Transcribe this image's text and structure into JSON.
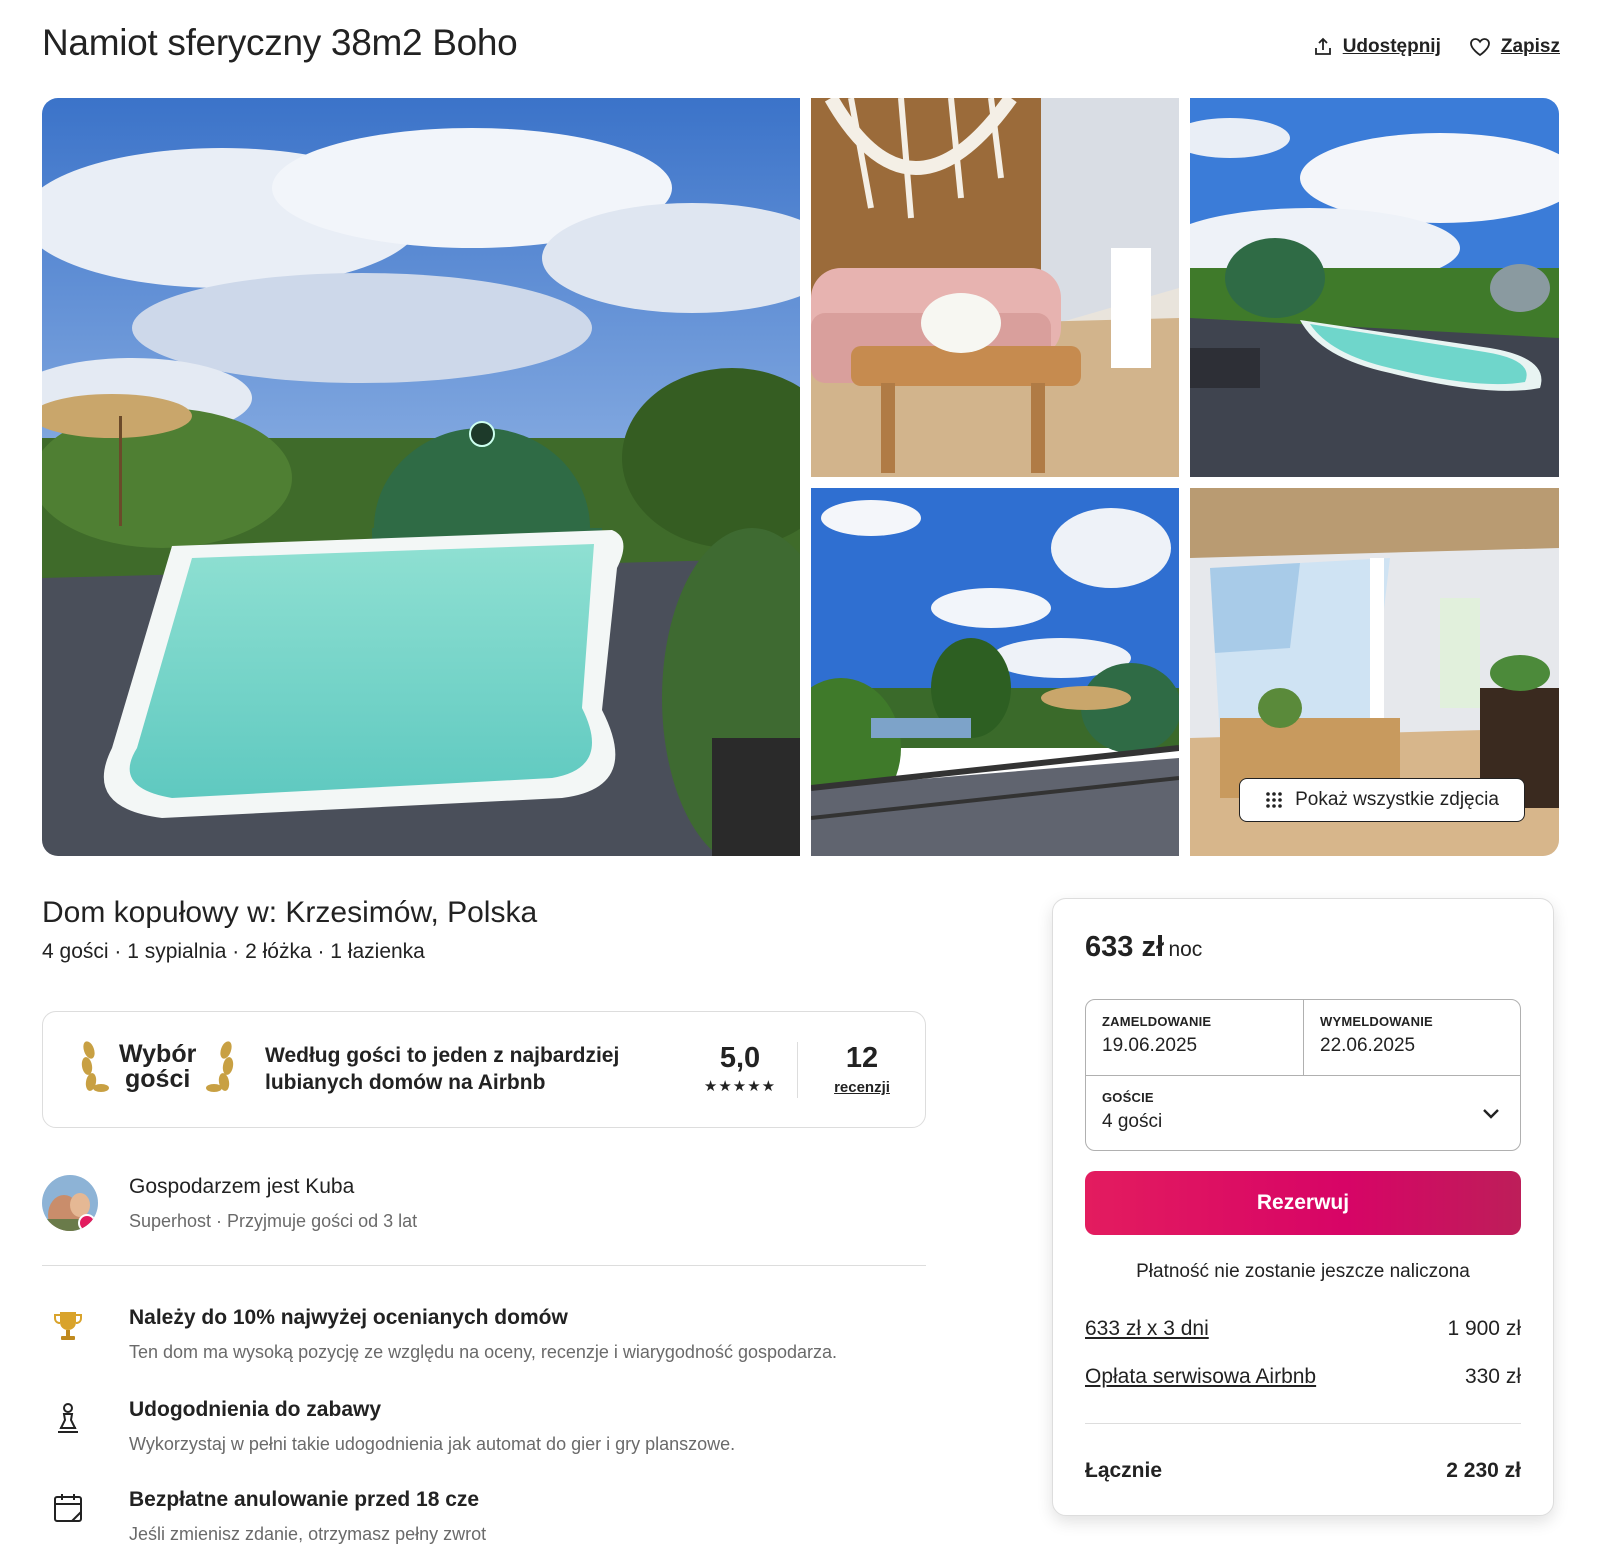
{
  "header": {
    "title": "Namiot sferyczny 38m2 Boho",
    "share_label": "Udostępnij",
    "save_label": "Zapisz"
  },
  "gallery": {
    "photos": [
      "pool-dome-exterior",
      "boho-living-room",
      "pool-aerial-view",
      "deck-lake-view",
      "dome-interior"
    ],
    "show_all_label": "Pokaż wszystkie zdjęcia"
  },
  "listing": {
    "subtitle": "Dom kopułowy w: Krzesimów, Polska",
    "specs": "4 gości · 1 sypialnia · 2 łóżka · 1 łazienka"
  },
  "guest_favorite": {
    "badge_line1": "Wybór",
    "badge_line2": "gości",
    "description": "Według gości to jeden z najbardziej lubianych domów na Airbnb",
    "rating": "5,0",
    "stars": "★★★★★",
    "reviews_count": "12",
    "reviews_label": "recenzji"
  },
  "host": {
    "name_line": "Gospodarzem jest Kuba",
    "meta": "Superhost · Przyjmuje gości od 3 lat"
  },
  "highlights": [
    {
      "icon": "trophy-icon",
      "title": "Należy do 10% najwyżej ocenianych domów",
      "text": "Ten dom ma wysoką pozycję ze względu na oceny, recenzje i wiarygodność gospodarza."
    },
    {
      "icon": "chess-pawn-icon",
      "title": "Udogodnienia do zabawy",
      "text": "Wykorzystaj w pełni takie udogodnienia jak automat do gier i gry planszowe."
    },
    {
      "icon": "calendar-icon",
      "title": "Bezpłatne anulowanie przed 18 cze",
      "text": "Jeśli zmienisz zdanie, otrzymasz pełny zwrot"
    }
  ],
  "booking": {
    "price": "633 zł",
    "price_unit": "noc",
    "checkin_label": "ZAMELDOWANIE",
    "checkin_value": "19.06.2025",
    "checkout_label": "WYMELDOWANIE",
    "checkout_value": "22.06.2025",
    "guests_label": "GOŚCIE",
    "guests_value": "4 gości",
    "reserve_label": "Rezerwuj",
    "no_charge": "Płatność nie zostanie jeszcze naliczona",
    "line_nights_label": "633 zł x 3 dni",
    "line_nights_value": "1 900 zł",
    "line_fee_label": "Opłata serwisowa Airbnb",
    "line_fee_value": "330 zł",
    "total_label": "Łącznie",
    "total_value": "2 230 zł"
  },
  "colors": {
    "brand": "#e31c5f",
    "text": "#222222",
    "muted": "#6a6a6a",
    "border": "#dddddd"
  }
}
